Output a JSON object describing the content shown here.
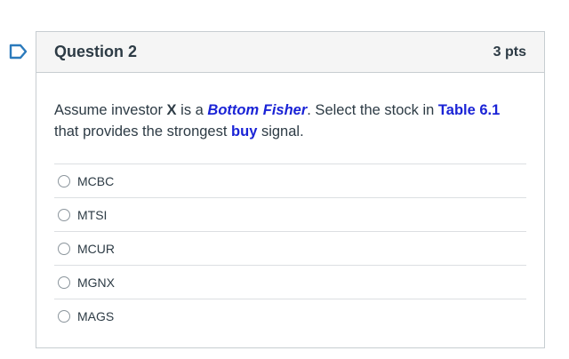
{
  "question": {
    "title": "Question 2",
    "points": "3 pts",
    "text": {
      "part1": "Assume investor ",
      "investor": "X",
      "part2": " is a ",
      "strategy": "Bottom Fisher",
      "part3": ". Select the stock in ",
      "table_ref": "Table 6.1",
      "part4": " that provides the strongest ",
      "signal": "buy",
      "part5": " signal."
    },
    "answers": [
      "MCBC",
      "MTSI",
      "MCUR",
      "MGNX",
      "MAGS"
    ]
  },
  "colors": {
    "accent_blue": "#1a23d6",
    "flag_blue": "#2b7abc",
    "header_bg": "#f5f5f5",
    "border": "#c7cdd1"
  },
  "icons": {
    "flag": "bookmark-flag-icon",
    "radio": "radio-unchecked-icon"
  }
}
